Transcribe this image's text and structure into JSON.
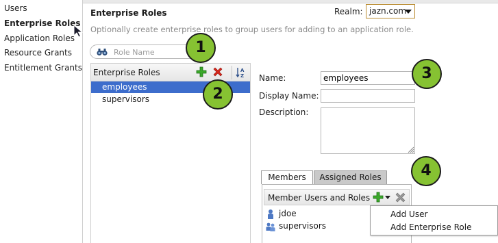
{
  "nav": {
    "items": [
      {
        "label": "Users",
        "active": false
      },
      {
        "label": "Enterprise Roles",
        "active": true
      },
      {
        "label": "Application Roles",
        "active": false
      },
      {
        "label": "Resource Grants",
        "active": false
      },
      {
        "label": "Entitlement Grants",
        "active": false
      }
    ]
  },
  "header": {
    "title": "Enterprise Roles",
    "description": "Optionally create enterprise roles to group users for adding to an application role.",
    "realm_label": "Realm:",
    "realm_value": "jazn.com"
  },
  "search": {
    "placeholder": "Role Name",
    "value": ""
  },
  "roles": {
    "header_label": "Enterprise Roles",
    "items": [
      {
        "label": "employees",
        "selected": true
      },
      {
        "label": "supervisors",
        "selected": false
      }
    ]
  },
  "form": {
    "name_label": "Name:",
    "name_value": "employees",
    "display_name_label": "Display Name:",
    "display_name_value": "",
    "description_label": "Description:",
    "description_value": ""
  },
  "members": {
    "tabs": [
      {
        "label": "Members",
        "active": true
      },
      {
        "label": "Assigned Roles",
        "active": false
      }
    ],
    "header_label": "Member Users and Roles",
    "items": [
      {
        "label": "jdoe",
        "icon": "user-icon"
      },
      {
        "label": "supervisors",
        "icon": "group-icon"
      }
    ],
    "add_menu": [
      {
        "label": "Add User"
      },
      {
        "label": "Add Enterprise Role"
      }
    ]
  },
  "callouts": [
    "1",
    "2",
    "3",
    "4"
  ],
  "colors": {
    "selection": "#3d6dcc",
    "callout": "#86c232",
    "realm_border": "#b98a2e"
  }
}
